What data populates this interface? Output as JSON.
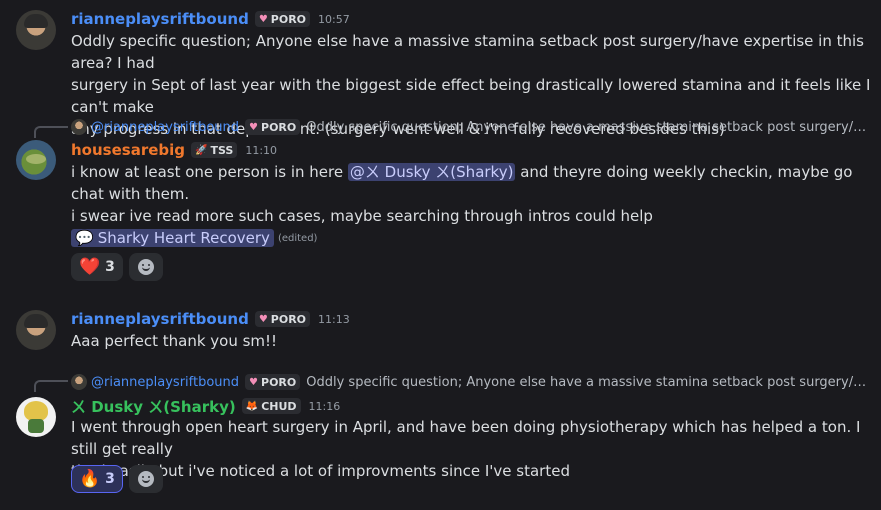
{
  "messages": [
    {
      "author": "rianneplaysriftbound",
      "tag": "PORO",
      "tag_icon": "♥",
      "time": "10:57",
      "lines": [
        "Oddly specific question; Anyone else have a massive stamina setback post surgery/have expertise in this area? I had",
        "surgery in Sept of last year with the biggest side effect being drastically lowered stamina and it feels like I can't make",
        "any progress in that department. (surgery went well & i'm fully recovered besides this)"
      ]
    },
    {
      "reply": {
        "author": "@rianneplaysriftbound",
        "tag": "PORO",
        "tag_icon": "♥",
        "text": "Oddly specific question; Anyone else have a massive stamina setback post surgery/have experti..."
      },
      "author": "housesarebig",
      "tag": "TSS",
      "tag_icon": "🚀",
      "time": "11:10",
      "line1_before": "i know at least one person is in here ",
      "mention": "@ㄨ Dusky ㄨ(Sharky)",
      "line1_after": " and theyre doing weekly checkin, maybe go chat with them.",
      "line2": "i swear ive read more such cases, maybe searching through intros could help",
      "channel": {
        "label": "Sharky Heart Recovery",
        "icon": "💬",
        "edited": "(edited)"
      },
      "reactions": [
        {
          "emoji": "❤️",
          "count": "3",
          "active": false
        }
      ]
    },
    {
      "author": "rianneplaysriftbound",
      "tag": "PORO",
      "tag_icon": "♥",
      "time": "11:13",
      "lines": [
        "Aaa perfect thank you sm!!"
      ]
    },
    {
      "reply": {
        "author": "@rianneplaysriftbound",
        "tag": "PORO",
        "tag_icon": "♥",
        "text": "Oddly specific question; Anyone else have a massive stamina setback post surgery/have experti..."
      },
      "author": "ㄨ Dusky ㄨ(Sharky)",
      "tag": "CHUD",
      "tag_icon": "🦊",
      "time": "11:16",
      "lines": [
        "I went through open heart surgery in April, and have been doing physiotherapy which has helped a ton. I still get really",
        "tired easily but i've noticed a lot of improvments since I've started"
      ],
      "reactions": [
        {
          "emoji": "🔥",
          "count": "3",
          "active": true
        }
      ]
    }
  ],
  "colors": {
    "background": "#1a1a1e",
    "username_blue": "#4b8ef7",
    "username_orange": "#f0782d",
    "username_green": "#37c15d",
    "mention_bg": "#3c4270"
  }
}
